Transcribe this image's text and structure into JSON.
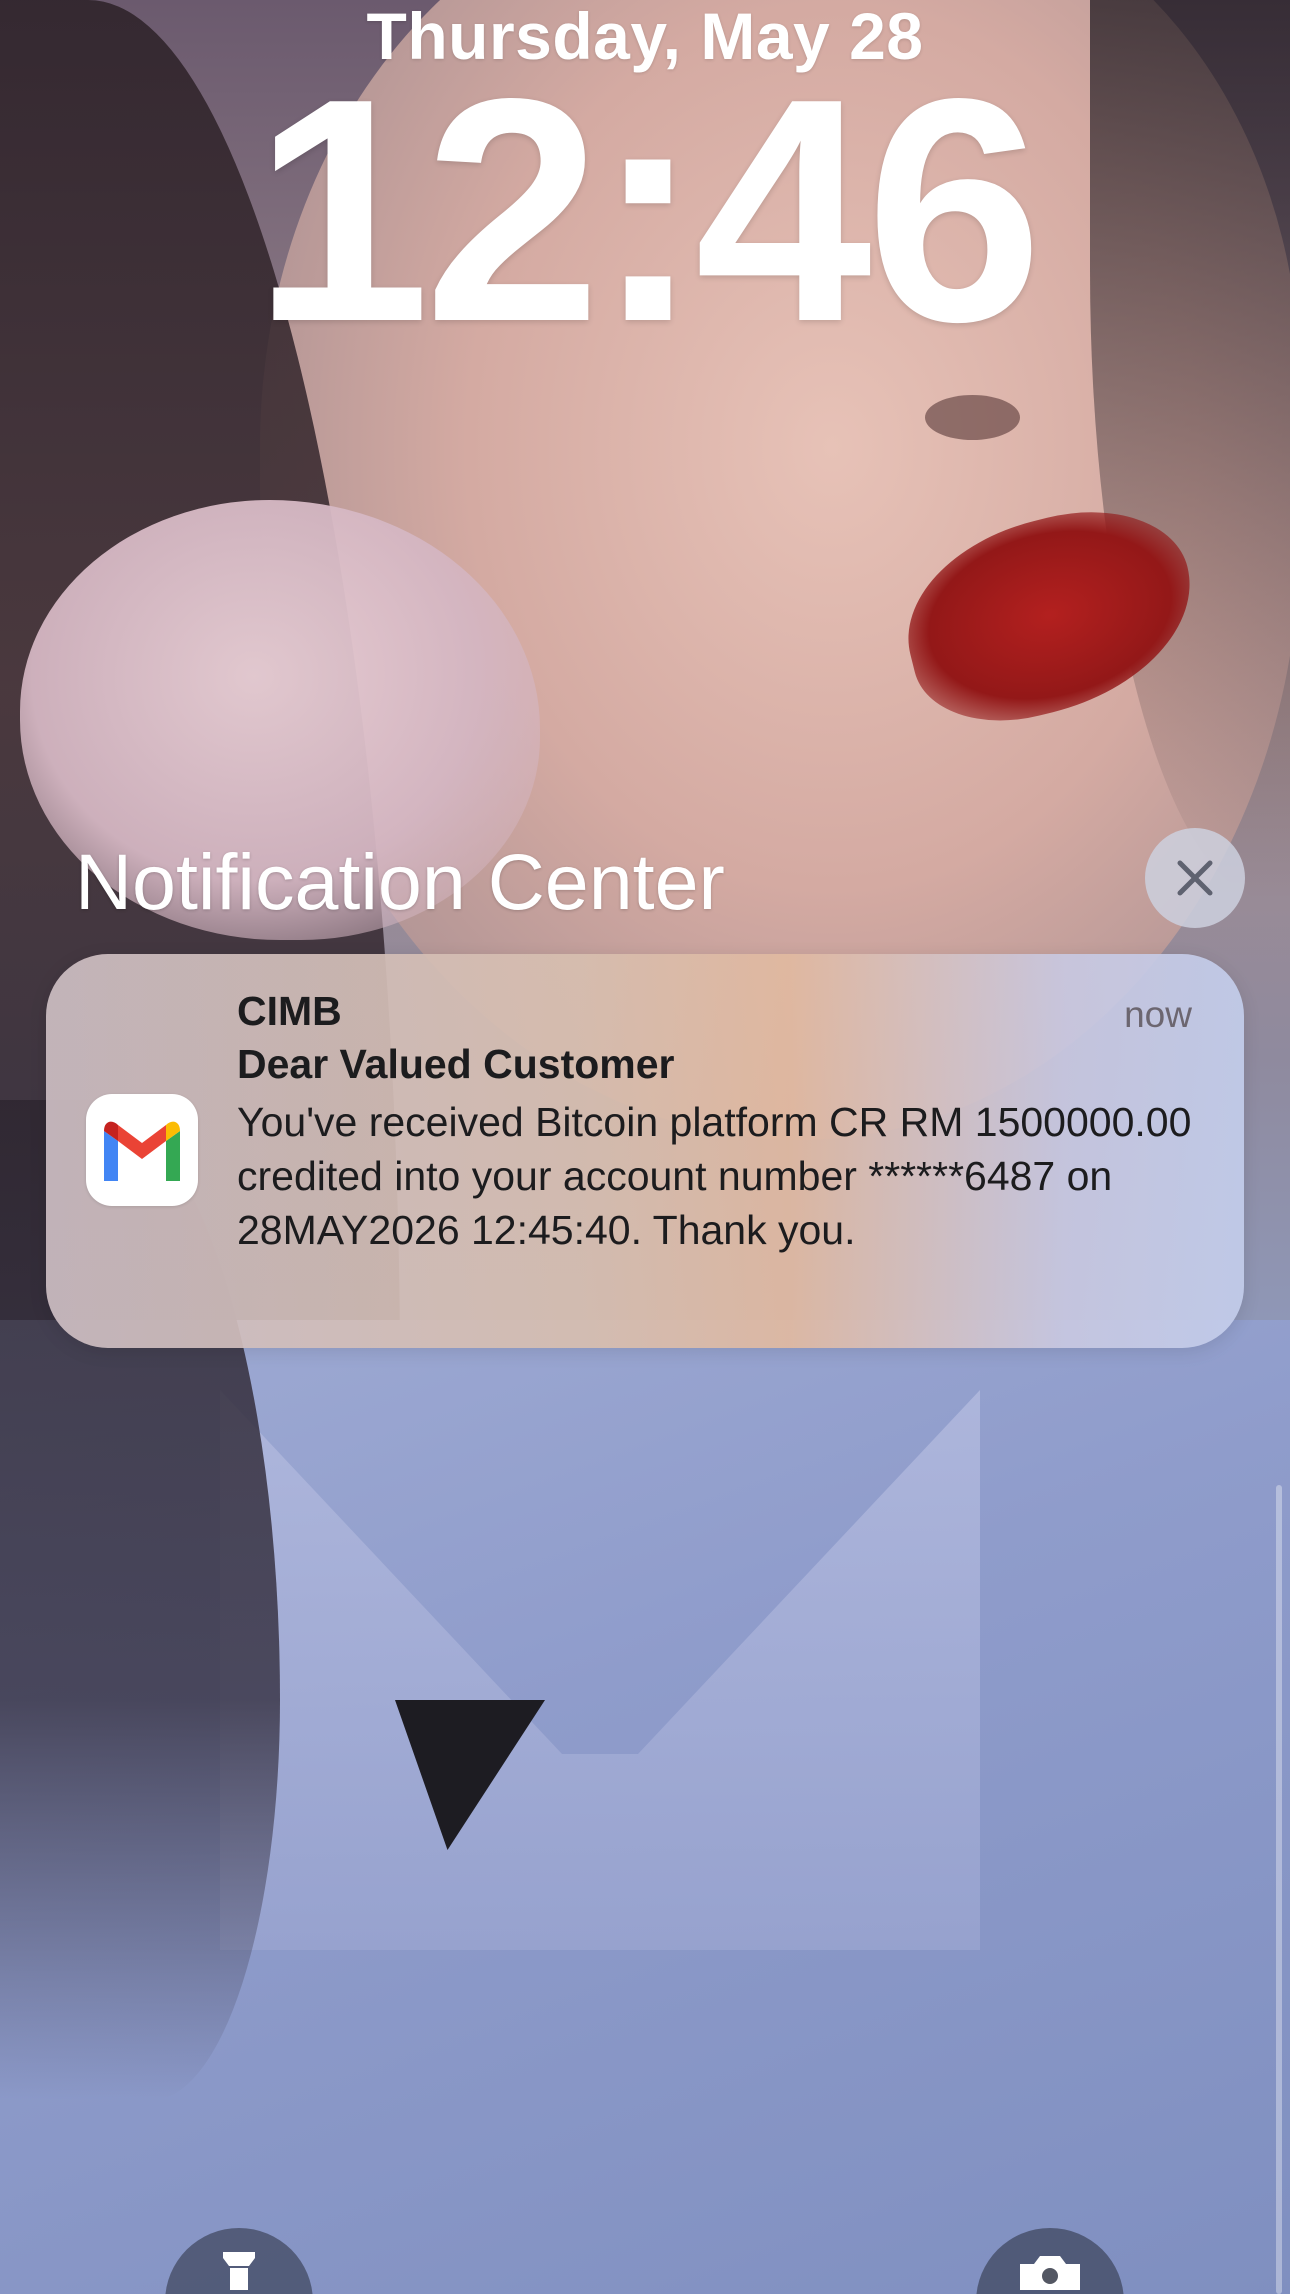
{
  "lockscreen": {
    "date": "Thursday, May 28",
    "time": "12:46"
  },
  "notification_center": {
    "title": "Notification Center",
    "close_icon": "close-icon"
  },
  "notification": {
    "app_icon": "gmail-icon",
    "sender": "CIMB",
    "time": "now",
    "title": "Dear Valued Customer",
    "body": "You've received Bitcoin platform CR RM 1500000.00 credited into your account number ******6487 on 28MAY2026 12:45:40. Thank you."
  },
  "quick_actions": {
    "left_icon": "flashlight-icon",
    "right_icon": "camera-icon"
  },
  "colors": {
    "gmail_red": "#EA4335",
    "gmail_blue": "#4285F4",
    "gmail_green": "#34A853",
    "gmail_yellow": "#FBBC04"
  }
}
